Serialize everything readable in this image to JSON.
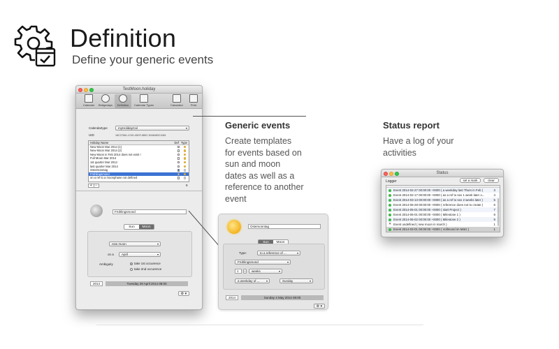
{
  "header": {
    "title": "Definition",
    "subtitle": "Define your generic events",
    "icon": "gear-calendar-icon"
  },
  "generic_events": {
    "title": "Generic events",
    "body": [
      "Create templates",
      "for events based on",
      "sun and moon",
      "dates as well as a",
      "reference to another",
      "event"
    ]
  },
  "status_report": {
    "title": "Status report",
    "body": [
      "Have a log of your",
      "activities"
    ]
  },
  "main_window": {
    "title": "TestMoon.holiday",
    "toolbar": [
      {
        "label": "Calendar",
        "icon": "calendar-icon"
      },
      {
        "label": "Bridgedays",
        "icon": "sun-icon"
      },
      {
        "label": "Definition",
        "icon": "gear-icon"
      },
      {
        "label": "Calendar Types",
        "icon": "calendar-types-icon"
      },
      {
        "label": "Calculator",
        "icon": "calculator-icon"
      },
      {
        "label": "Print",
        "icon": "printer-icon"
      }
    ],
    "calendartype_label": "Calendartype",
    "calendartype_value": "myHolidayCal",
    "uid_label": "UID",
    "uid_value": "18C27681-1C90-4DDF-8B67-6348483C1084",
    "list_headers": {
      "name": "Holiday Name",
      "def": "Def",
      "type": "Type"
    },
    "list_items": [
      "New Moon Mar 2014 (1)",
      "New Moon Mar 2014 (2)",
      "New Moon in Feb 2014 does not exist !",
      "Full Moon Mar 2014",
      "1st quarter Mar 2014",
      "last quarter Mar 2014",
      "Ostersonntag",
      "Frühlingsmond",
      "on a ref to a moonphase not defined"
    ],
    "list_count": "9",
    "add_label": "+",
    "remove_label": "−",
    "event_name": "Frühlingsmond",
    "seg_sun": "Sun",
    "seg_moon": "Moon",
    "moon_phase": "new moon",
    "on_a_label": "on a",
    "on_a_value": "April",
    "ambiguity_label": "Ambiguity",
    "ambiguity_opt1": "take 1st occurence",
    "ambiguity_opt2": "take 2nd occurence",
    "year": "2014",
    "date_result": "Tuesday 29 April 2014 08:00",
    "gear_label": "⚙ ▾"
  },
  "ref_panel": {
    "event_name": "Ostersonntag",
    "seg_sun": "Sun",
    "seg_moon": "Moon",
    "type_label": "Type:",
    "type_value": "to a reference of ...",
    "ref_value": "Frühlingsmond",
    "count_value": "1",
    "unit_value": "weeks",
    "weekday_mode": "a weekday of ...",
    "weekday_value": "Sunday",
    "year": "2014",
    "date_result": "Sunday 4 May 2014 08:00",
    "gear_label": "⚙ ▾"
  },
  "status_window": {
    "title": "Status",
    "set_mark": "set a mark",
    "clear": "clear",
    "logger_label": "Logger",
    "rows": [
      {
        "text": "Event 2014-02-27 00:00:00 +0000 ( a weekday last Thurs in Feb )",
        "num": "3",
        "status": "ok"
      },
      {
        "text": "Event 2014-02-17 00:00:00 +0000 ( as a ref to sex 1 week later o...",
        "num": "4",
        "status": "ok"
      },
      {
        "text": "Event 2014-03-13 00:00:00 +0000 ( as a ref to sex 2 weeks later )",
        "num": "5",
        "status": "ok"
      },
      {
        "text": "Event 2014-06-28 00:00:00 +0000 ( reference does not to create )",
        "num": "6",
        "status": "ok"
      },
      {
        "text": "Event 2014-05-01 00:00:00 +0000 ( start Project )",
        "num": "7",
        "status": "ok"
      },
      {
        "text": "Event 2014-06-01 00:00:00 +0000 ( Milestone 1 )",
        "num": "8",
        "status": "ok"
      },
      {
        "text": "Event 2014-06-02 00:00:00 +0000 ( Milestone 2 )",
        "num": "9",
        "status": "ok"
      },
      {
        "text": "Event undefined ( new moon in march )",
        "num": "1",
        "status": "error"
      },
      {
        "text": "Event 2014-03-01 00:00:00 +0000 ( Vollmond im März )",
        "num": "1",
        "status": "ok"
      }
    ]
  }
}
